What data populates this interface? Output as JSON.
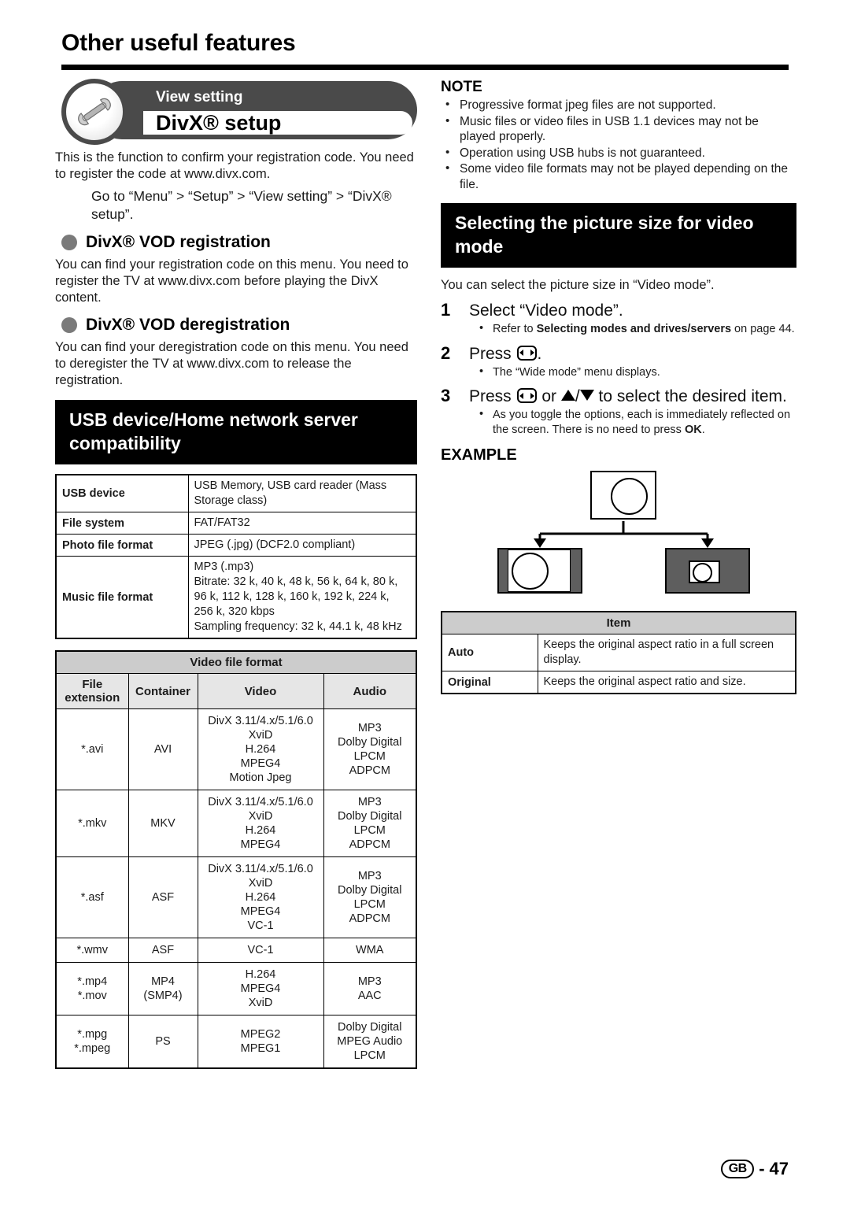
{
  "page": {
    "title": "Other useful features",
    "footer_region": "GB",
    "footer_separator": "-",
    "footer_page": "47"
  },
  "banner": {
    "eyebrow": "View setting",
    "title": "DivX® setup",
    "icon": "wrench-icon"
  },
  "left": {
    "intro": "This is the function to confirm your registration code. You need to register the code at www.divx.com.",
    "path_note": "Go to “Menu” > “Setup” > “View setting” > “DivX® setup”.",
    "sections": [
      {
        "heading": "DivX® VOD registration",
        "body": "You can find your registration code on this menu. You need to register the TV at www.divx.com before playing the DivX content."
      },
      {
        "heading": "DivX® VOD deregistration",
        "body": "You can find your deregistration code on this menu. You need to deregister the TV at www.divx.com to release the registration."
      }
    ],
    "usb_heading": "USB device/Home network server compatibility",
    "usb_table": [
      {
        "key": "USB device",
        "value": "USB Memory, USB card reader (Mass Storage class)"
      },
      {
        "key": "File system",
        "value": "FAT/FAT32"
      },
      {
        "key": "Photo file format",
        "value": "JPEG (.jpg) (DCF2.0 compliant)"
      },
      {
        "key": "Music file format",
        "value": "MP3 (.mp3)\nBitrate: 32 k, 40 k, 48 k, 56 k, 64 k, 80 k, 96 k, 112 k, 128 k, 160 k, 192 k, 224 k, 256 k, 320 kbps\nSampling frequency: 32 k, 44.1 k, 48 kHz"
      }
    ],
    "video_table": {
      "caption": "Video file format",
      "headers": [
        "File extension",
        "Container",
        "Video",
        "Audio"
      ],
      "rows": [
        {
          "ext": "*.avi",
          "container": "AVI",
          "video": "DivX 3.11/4.x/5.1/6.0\nXviD\nH.264\nMPEG4\nMotion Jpeg",
          "audio": "MP3\nDolby Digital\nLPCM\nADPCM"
        },
        {
          "ext": "*.mkv",
          "container": "MKV",
          "video": "DivX 3.11/4.x/5.1/6.0\nXviD\nH.264\nMPEG4",
          "audio": "MP3\nDolby Digital\nLPCM\nADPCM"
        },
        {
          "ext": "*.asf",
          "container": "ASF",
          "video": "DivX 3.11/4.x/5.1/6.0\nXviD\nH.264\nMPEG4\nVC-1",
          "audio": "MP3\nDolby Digital\nLPCM\nADPCM"
        },
        {
          "ext": "*.wmv",
          "container": "ASF",
          "video": "VC-1",
          "audio": "WMA"
        },
        {
          "ext": "*.mp4\n*.mov",
          "container": "MP4\n(SMP4)",
          "video": "H.264\nMPEG4\nXviD",
          "audio": "MP3\nAAC"
        },
        {
          "ext": "*.mpg\n*.mpeg",
          "container": "PS",
          "video": "MPEG2\nMPEG1",
          "audio": "Dolby Digital\nMPEG Audio\nLPCM"
        }
      ]
    }
  },
  "right": {
    "note_title": "NOTE",
    "notes": [
      "Progressive format jpeg files are not supported.",
      "Music files or video files in USB 1.1 devices may not be played properly.",
      "Operation using USB hubs is not guaranteed.",
      "Some video file formats may not be played depending on the file."
    ],
    "picture_heading": "Selecting the picture size for video mode",
    "picture_intro": "You can select the picture size in “Video mode”.",
    "steps": [
      {
        "num": "1",
        "main": "Select “Video mode”.",
        "sub_pre": "Refer to ",
        "sub_bold": "Selecting modes and drives/servers",
        "sub_post": " on page 44."
      },
      {
        "num": "2",
        "main_pre": "Press ",
        "main_post": ".",
        "sub": "The “Wide mode” menu displays."
      },
      {
        "num": "3",
        "main_pre": "Press ",
        "main_mid": " or ",
        "main_post": " to select the desired item.",
        "sub_pre": "As you toggle the options, each is immediately reflected on the screen. There is no need to press ",
        "sub_bold": "OK",
        "sub_post": "."
      }
    ],
    "example_title": "EXAMPLE",
    "item_table": {
      "header": "Item",
      "rows": [
        {
          "name": "Auto",
          "desc": "Keeps the original aspect ratio in a full screen display."
        },
        {
          "name": "Original",
          "desc": "Keeps the original aspect ratio and size."
        }
      ]
    }
  }
}
